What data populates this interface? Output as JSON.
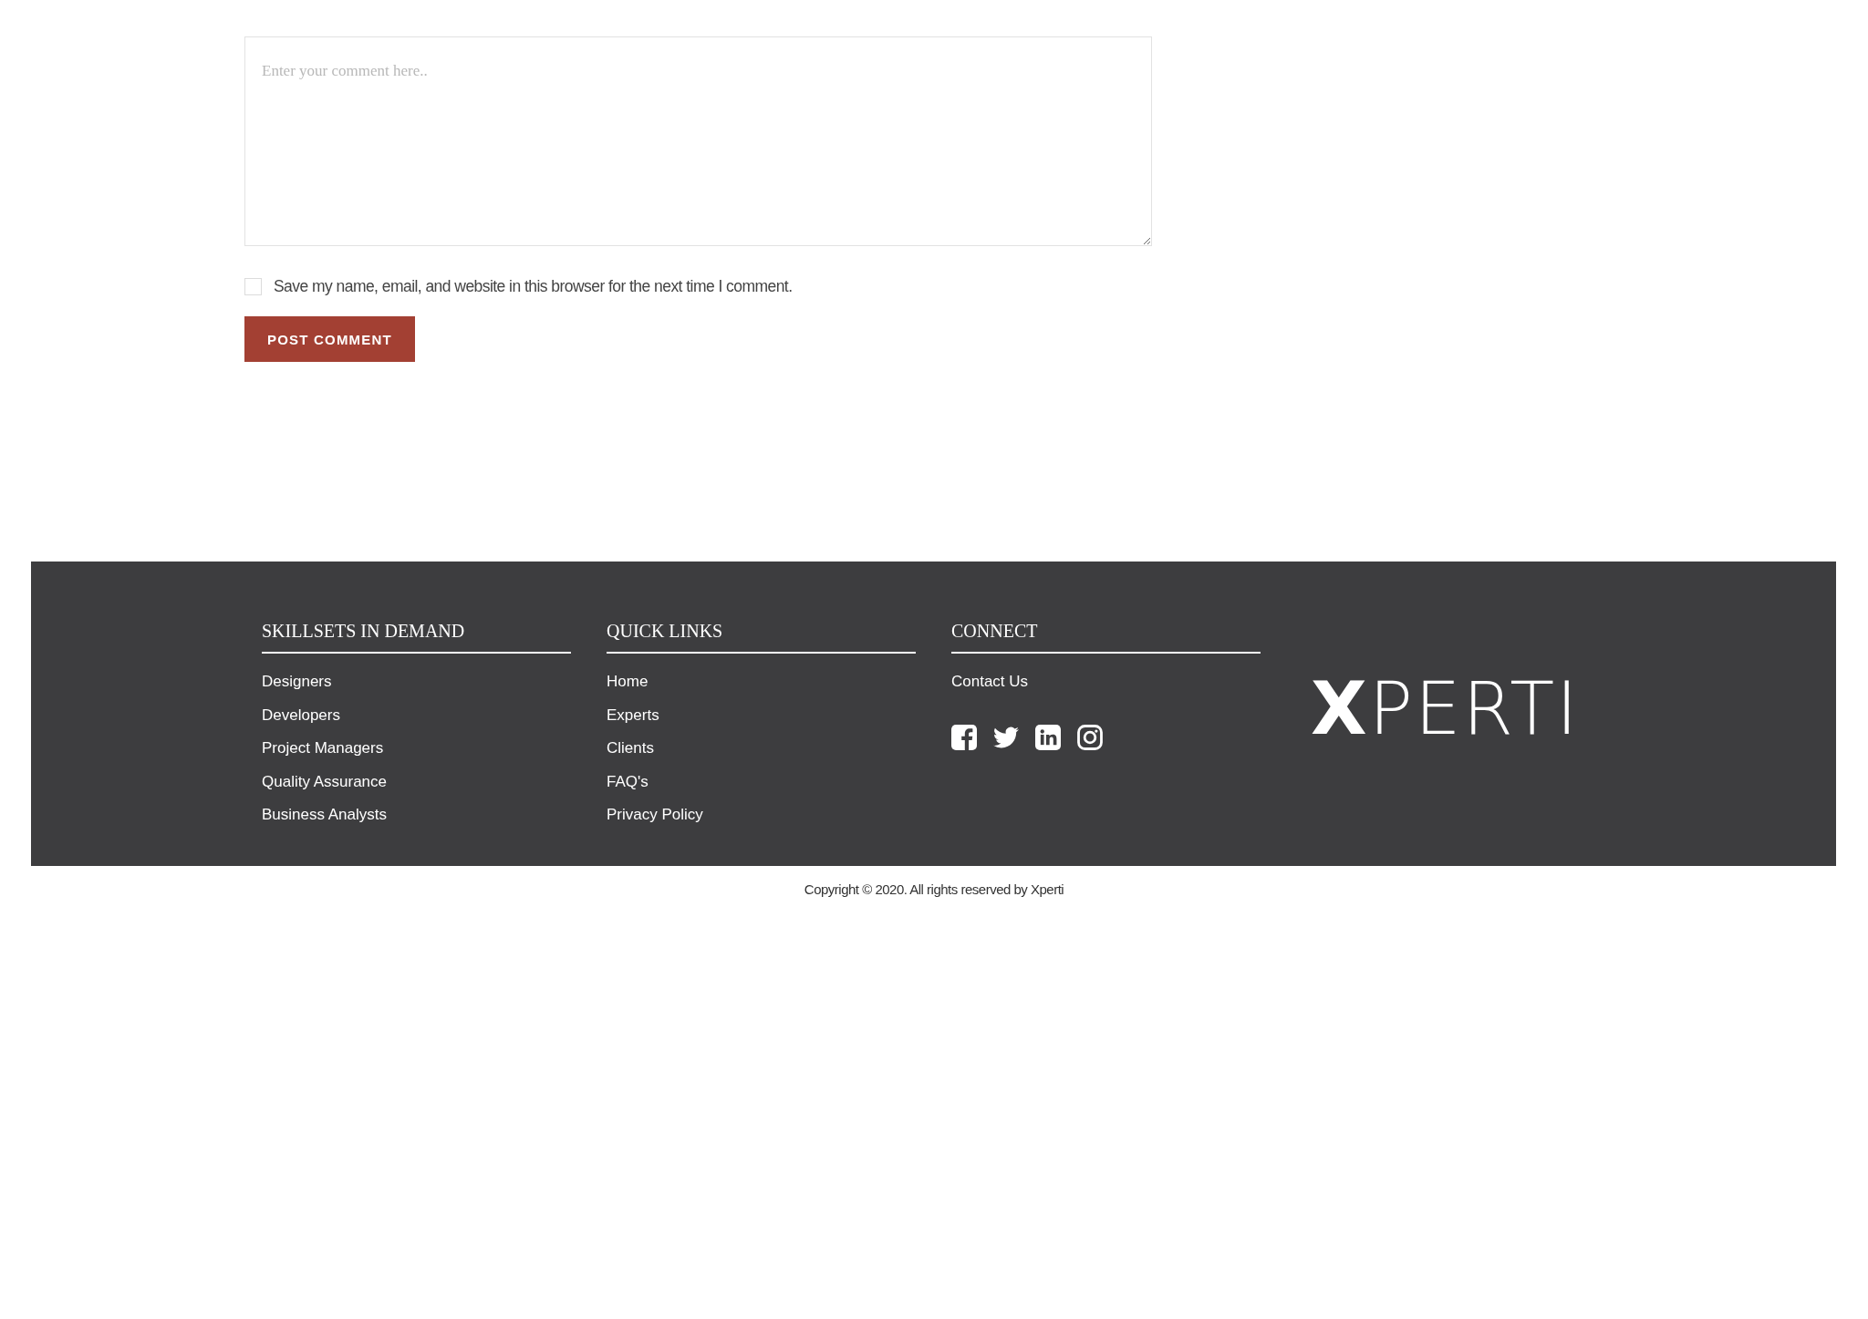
{
  "comment_form": {
    "comment": {
      "placeholder": "Enter your comment here.."
    },
    "save_info": {
      "label": "Save my name, email, and website in this browser for the next time I comment.",
      "checked": false
    },
    "submit": {
      "label": "POST COMMENT"
    }
  },
  "footer": {
    "columns": [
      {
        "heading": "SKILLSETS IN DEMAND",
        "links": [
          "Designers",
          "Developers",
          "Project Managers",
          "Quality Assurance",
          "Business Analysts"
        ]
      },
      {
        "heading": "QUICK LINKS",
        "links": [
          "Home",
          "Experts",
          "Clients",
          "FAQ's",
          "Privacy Policy"
        ]
      },
      {
        "heading": "CONNECT",
        "links": [
          "Contact Us"
        ],
        "social": [
          {
            "kind": "facebook"
          },
          {
            "kind": "twitter"
          },
          {
            "kind": "linkedin"
          },
          {
            "kind": "instagram"
          }
        ]
      }
    ],
    "logo": "**X**PERTI"
  },
  "copyright": "Copyright © 2020. All rights reserved by Xperti"
}
